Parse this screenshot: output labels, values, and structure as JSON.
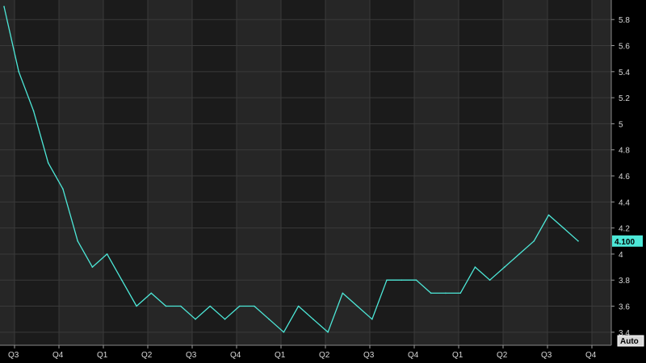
{
  "chart_data": {
    "type": "line",
    "x_tick_labels": [
      "Q3",
      "Q4",
      "Q1",
      "Q2",
      "Q3",
      "Q4",
      "Q1",
      "Q2",
      "Q3",
      "Q4",
      "Q1",
      "Q2",
      "Q3",
      "Q4"
    ],
    "y_tick_labels": [
      "3.4",
      "3.6",
      "3.8",
      "4",
      "4.2",
      "4.4",
      "4.6",
      "4.8",
      "5",
      "5.2",
      "5.4",
      "5.6",
      "5.8"
    ],
    "ylim": [
      3.3,
      5.95
    ],
    "grid": true,
    "series": [
      {
        "values": [
          5.9,
          5.4,
          5.1,
          4.7,
          4.5,
          4.1,
          3.9,
          4.0,
          3.8,
          3.6,
          3.7,
          3.6,
          3.6,
          3.5,
          3.6,
          3.5,
          3.6,
          3.6,
          3.5,
          3.4,
          3.6,
          3.5,
          3.4,
          3.7,
          3.6,
          3.5,
          3.8,
          3.8,
          3.8,
          3.7,
          3.7,
          3.7,
          3.9,
          3.8,
          3.9,
          4.0,
          4.1,
          4.3,
          4.2,
          4.1
        ]
      }
    ],
    "last_value_label": "4.100",
    "auto_button": "Auto",
    "colors": {
      "background": "#000000",
      "plot_band_dark": "#1b1b1b",
      "plot_band_light": "#262626",
      "grid": "#3a3a3a",
      "line": "#4de8d8",
      "last_value_bg": "#4de8d8",
      "text": "#d8d8d8"
    }
  }
}
